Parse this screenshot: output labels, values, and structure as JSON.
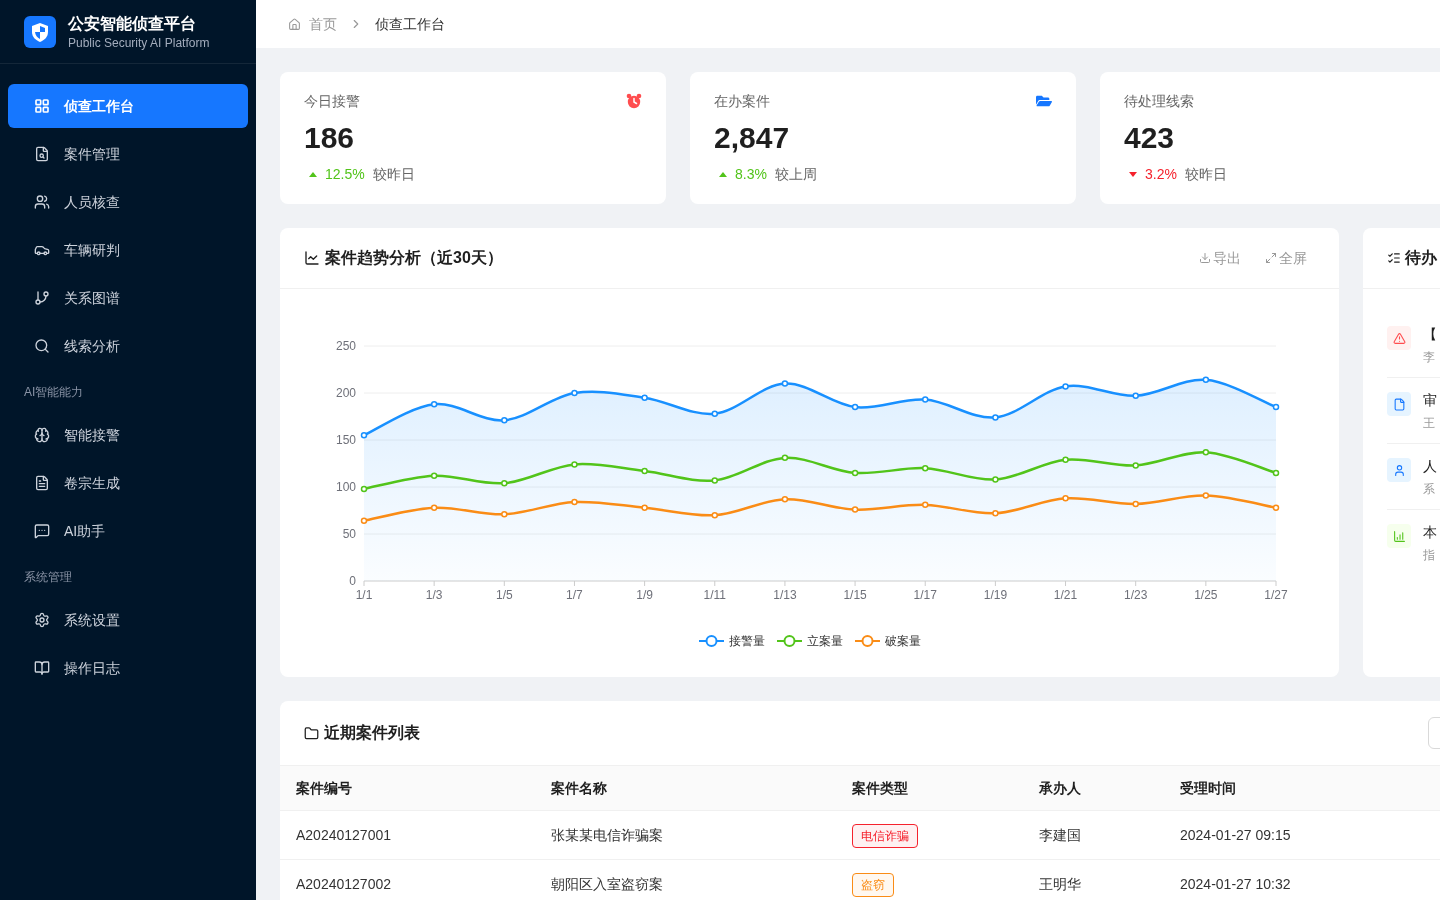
{
  "sidebar": {
    "brand": {
      "title": "公安智能侦查平台",
      "subtitle": "Public Security AI Platform"
    },
    "groups": [
      {
        "items": [
          {
            "label": "侦查工作台",
            "selected": true
          },
          {
            "label": "案件管理",
            "selected": false
          },
          {
            "label": "人员核查",
            "selected": false
          },
          {
            "label": "车辆研判",
            "selected": false
          },
          {
            "label": "关系图谱",
            "selected": false
          },
          {
            "label": "线索分析",
            "selected": false
          }
        ]
      },
      {
        "heading": "AI智能能力",
        "items": [
          {
            "label": "智能接警",
            "selected": false
          },
          {
            "label": "卷宗生成",
            "selected": false
          },
          {
            "label": "AI助手",
            "selected": false
          }
        ]
      },
      {
        "heading": "系统管理",
        "items": [
          {
            "label": "系统设置",
            "selected": false
          },
          {
            "label": "操作日志",
            "selected": false
          }
        ]
      }
    ]
  },
  "breadcrumb": [
    "首页",
    "侦查工作台"
  ],
  "stats": [
    {
      "label": "今日接警",
      "value": "186",
      "increase": true,
      "change": "12.5%",
      "comparison": "较昨日"
    },
    {
      "label": "在办案件",
      "value": "2,847",
      "increase": true,
      "change": "8.3%",
      "comparison": "较上周"
    },
    {
      "label": "待处理线索",
      "value": "423",
      "increase": false,
      "change": "3.2%",
      "comparison": "较昨日"
    }
  ],
  "trend_chart": {
    "title": "案件趋势分析（近30天）",
    "actions": [
      "导出",
      "全屏"
    ],
    "chart_data": {
      "type": "line",
      "categories": [
        "1/1",
        "1/3",
        "1/5",
        "1/7",
        "1/9",
        "1/11",
        "1/13",
        "1/15",
        "1/17",
        "1/19",
        "1/21",
        "1/23",
        "1/25",
        "1/27"
      ],
      "series": [
        {
          "name": "接警量",
          "type": "area",
          "marker": "circle",
          "color": "#1890ff",
          "values": [
            155,
            188,
            171,
            200,
            195,
            178,
            210,
            185,
            193,
            174,
            207,
            197,
            214,
            185
          ]
        },
        {
          "name": "立案量",
          "type": "line",
          "marker": "circle",
          "color": "#52c41a",
          "values": [
            98,
            112,
            104,
            124,
            117,
            107,
            131,
            115,
            120,
            108,
            129,
            123,
            137,
            115
          ]
        },
        {
          "name": "破案量",
          "type": "line",
          "marker": "circle",
          "color": "#fa8c16",
          "values": [
            64,
            78,
            71,
            84,
            78,
            70,
            87,
            76,
            81,
            72,
            88,
            82,
            91,
            78
          ]
        }
      ],
      "ylim": [
        0,
        250
      ],
      "yticks": [
        0,
        50,
        100,
        150,
        200,
        250
      ],
      "grid": true,
      "legend": "bottom"
    }
  },
  "todo_panel": {
    "title": "待办",
    "items": [
      {
        "kind": "alert",
        "title": "【",
        "subtitle": "李"
      },
      {
        "kind": "document",
        "title": "审",
        "subtitle": "王"
      },
      {
        "kind": "person",
        "title": "人",
        "subtitle": "系"
      },
      {
        "kind": "chart",
        "title": "本",
        "subtitle": "指"
      }
    ]
  },
  "case_table": {
    "title": "近期案件列表",
    "columns": [
      "案件编号",
      "案件名称",
      "案件类型",
      "承办人",
      "受理时间"
    ],
    "rows": [
      {
        "case_no": "A20240127001",
        "name": "张某某电信诈骗案",
        "type": {
          "label": "电信诈骗",
          "color": "#f5222d"
        },
        "handler": "李建国",
        "received": "2024-01-27 09:15"
      },
      {
        "case_no": "A20240127002",
        "name": "朝阳区入室盗窃案",
        "type": {
          "label": "盗窃",
          "color": "#fa8c16"
        },
        "handler": "王明华",
        "received": "2024-01-27 10:32"
      }
    ]
  }
}
